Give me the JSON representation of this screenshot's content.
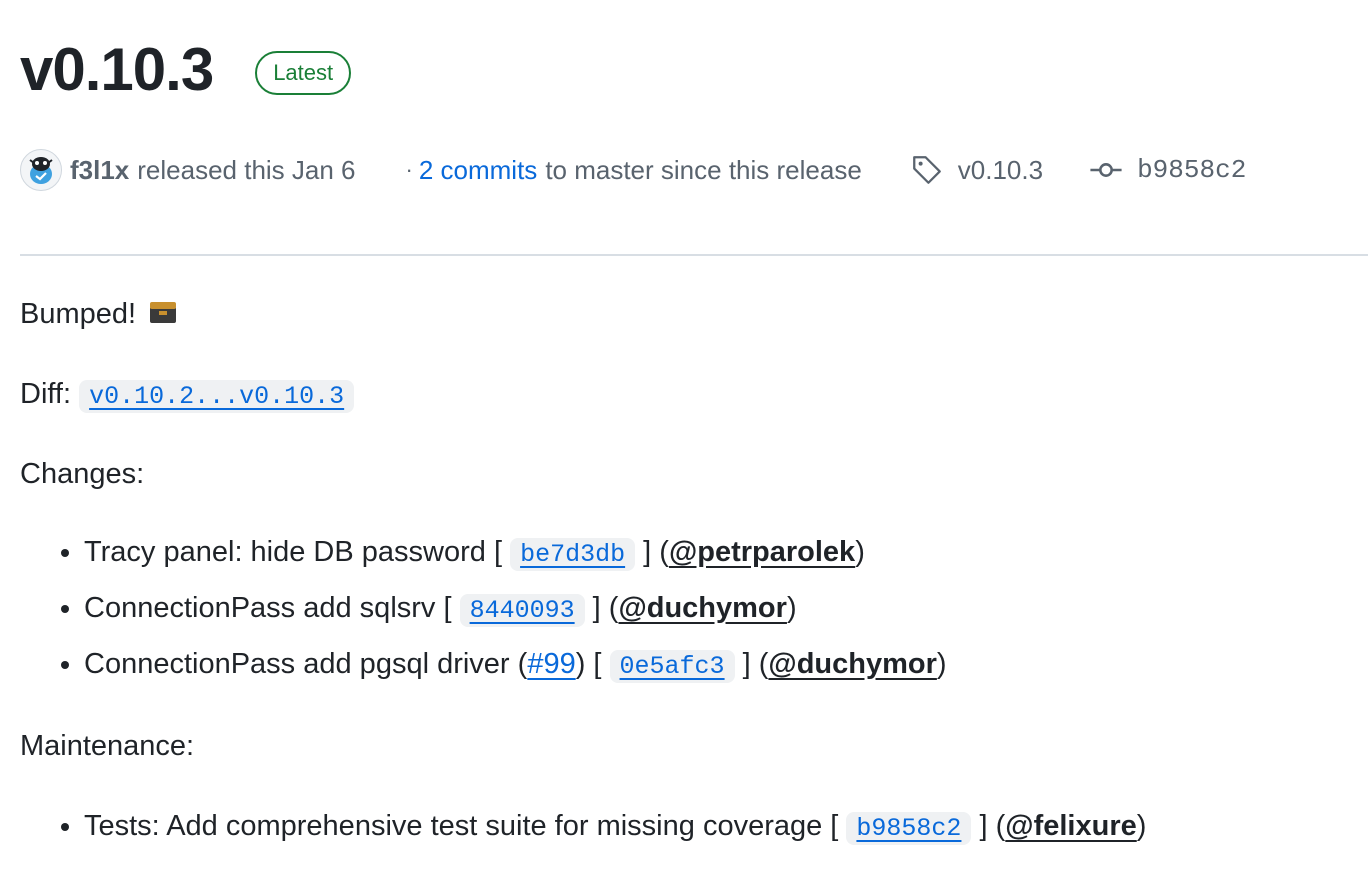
{
  "release": {
    "title": "v0.10.3",
    "badge": "Latest",
    "author": "f3l1x",
    "released_text": "released this Jan 6",
    "dot": "·",
    "commits_link": "2 commits",
    "commits_tail": "to master since this release",
    "tag": "v0.10.3",
    "commit_sha": "b9858c2"
  },
  "icons": {
    "avatar": "avatar-icon",
    "tag": "tag-icon",
    "commit": "git-commit-icon",
    "emoji": "package-box-emoji"
  },
  "notes": {
    "bumped": "Bumped!",
    "diff_label": "Diff:",
    "diff_link": "v0.10.2...v0.10.3",
    "changes_heading": "Changes:",
    "changes": [
      {
        "text": "Tracy panel: hide DB password",
        "issue": "",
        "sha": "be7d3db",
        "author": "@petrparolek"
      },
      {
        "text": "ConnectionPass add sqlsrv",
        "issue": "",
        "sha": "8440093",
        "author": "@duchymor"
      },
      {
        "text": "ConnectionPass add pgsql driver",
        "issue": "#99",
        "sha": "0e5afc3",
        "author": "@duchymor"
      }
    ],
    "maintenance_heading": "Maintenance:",
    "maintenance": [
      {
        "text": "Tests: Add comprehensive test suite for missing coverage",
        "sha": "b9858c2",
        "author": "@felixure"
      }
    ]
  },
  "colors": {
    "link": "#0969da",
    "badge_green": "#1a7f37",
    "muted": "#59636e"
  }
}
